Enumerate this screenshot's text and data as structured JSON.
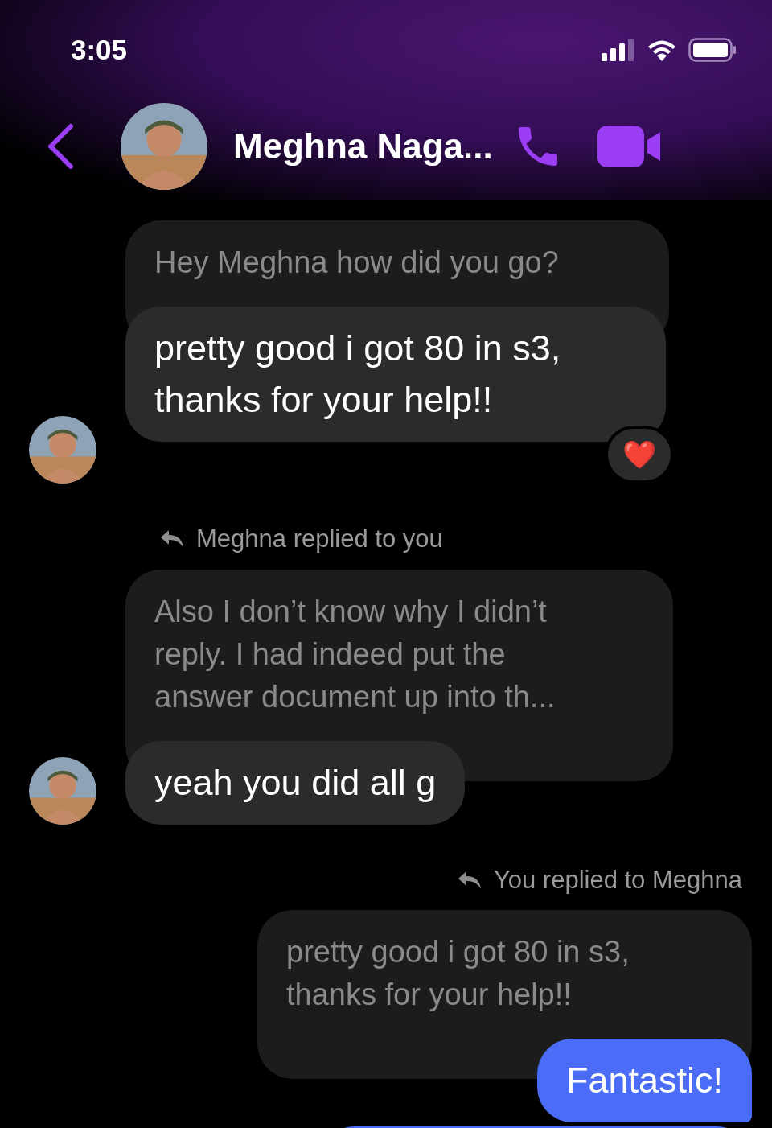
{
  "status_bar": {
    "time": "3:05"
  },
  "header": {
    "title": "Meghna Naga..."
  },
  "messages": [
    {
      "kind": "incoming",
      "quote": "Hey Meghna how did you go?",
      "text": "pretty good i got 80 in s3, thanks for your help!!",
      "reaction": "❤️"
    },
    {
      "kind": "incoming",
      "reply_label": "Meghna replied to you",
      "quote": "Also I don’t know why I didn’t reply. I had indeed put the answer document up into th...",
      "text": "yeah you did all g"
    },
    {
      "kind": "outgoing",
      "reply_label": "You replied to Meghna",
      "quote": "pretty good i got 80 in s3, thanks for your help!!",
      "text": "Fantastic!"
    }
  ]
}
